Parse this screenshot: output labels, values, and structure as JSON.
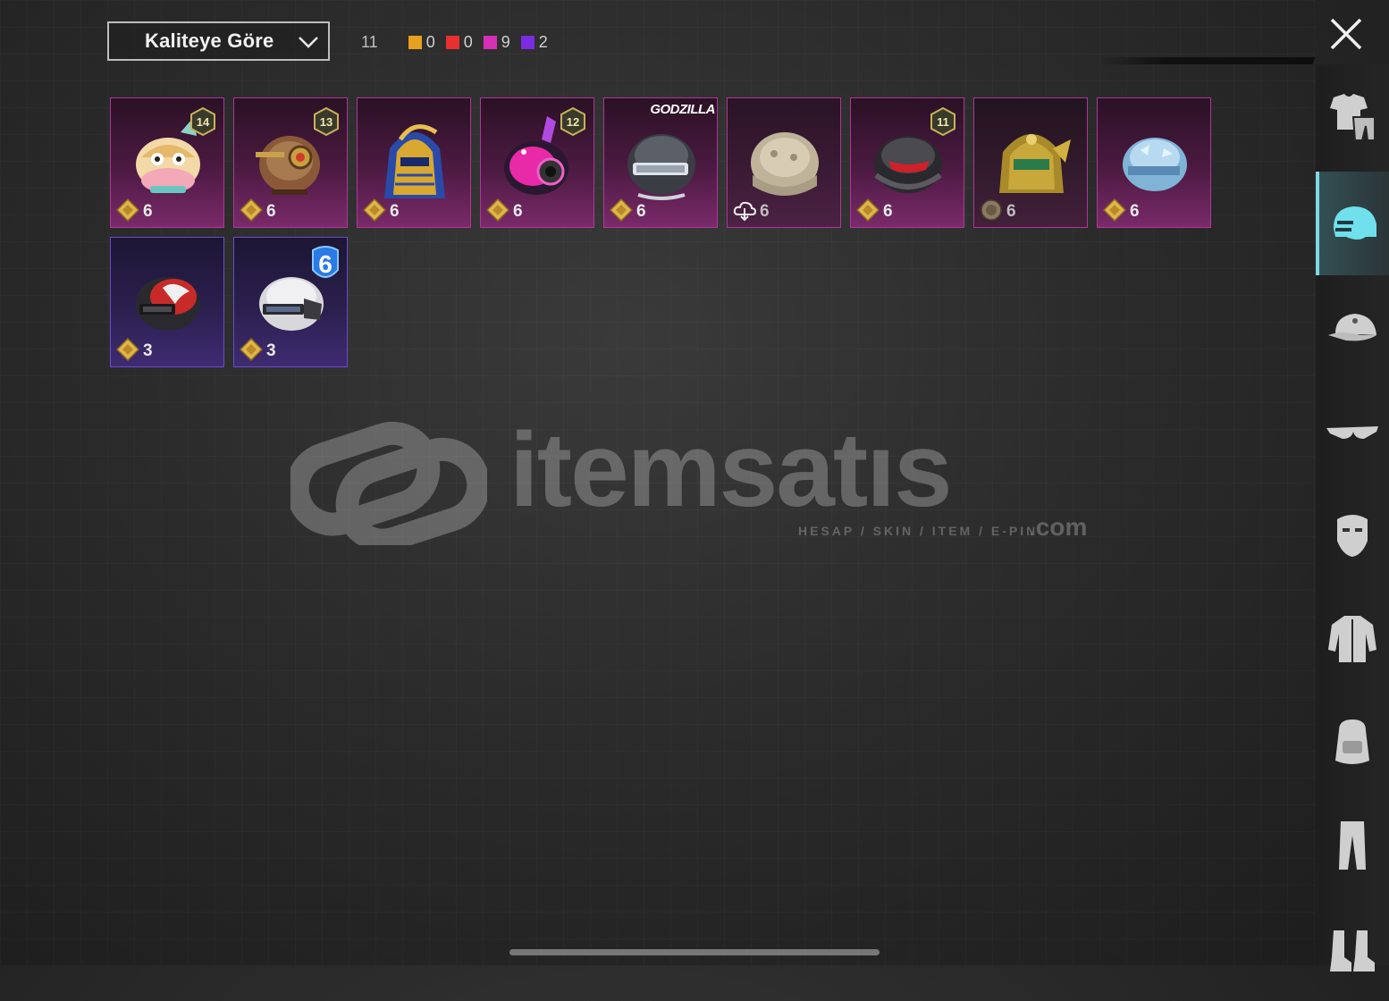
{
  "toolbar": {
    "sort_label": "Kaliteye Göre",
    "total_count": "11",
    "rarity_counts": [
      {
        "color": "#e8a020",
        "value": "0"
      },
      {
        "color": "#e83030",
        "value": "0"
      },
      {
        "color": "#d62fb8",
        "value": "9"
      },
      {
        "color": "#7b2be0",
        "value": "2"
      }
    ]
  },
  "items": [
    {
      "count": "6",
      "level": "14",
      "icon": "lion-dance-helmet",
      "currency": "gold"
    },
    {
      "count": "6",
      "level": "13",
      "icon": "steampunk-helmet",
      "currency": "gold"
    },
    {
      "count": "6",
      "level": "",
      "icon": "pharaoh-helmet",
      "currency": "gold"
    },
    {
      "count": "6",
      "level": "12",
      "icon": "neon-bunny-helmet",
      "currency": "gold"
    },
    {
      "count": "6",
      "brand": "GODZILLA",
      "icon": "godzilla-helmet",
      "currency": "gold"
    },
    {
      "count": "6",
      "level": "",
      "icon": "lace-helmet",
      "currency": "cloud"
    },
    {
      "count": "6",
      "level": "11",
      "icon": "ninja-helmet",
      "currency": "gold"
    },
    {
      "count": "6",
      "level": "",
      "icon": "golden-warrior-helmet",
      "currency": "bronze"
    },
    {
      "count": "6",
      "level": "",
      "icon": "ice-helmet",
      "currency": "gold"
    },
    {
      "count": "3",
      "level": "",
      "icon": "red-flame-helmet",
      "currency": "gold"
    },
    {
      "count": "3",
      "badge": "6",
      "icon": "white-carbon-helmet",
      "currency": "gold"
    }
  ],
  "watermark": {
    "text": "itemsatıs",
    "sub": "HESAP / SKIN / ITEM / E-PIN",
    "dotcom": ".com"
  },
  "sidebar": [
    {
      "icon": "outfit-icon"
    },
    {
      "icon": "helmet-icon",
      "active": true
    },
    {
      "icon": "cap-icon"
    },
    {
      "icon": "glasses-icon"
    },
    {
      "icon": "mask-icon"
    },
    {
      "icon": "jacket-icon"
    },
    {
      "icon": "backpack-icon"
    },
    {
      "icon": "pants-icon"
    },
    {
      "icon": "boots-icon"
    }
  ]
}
